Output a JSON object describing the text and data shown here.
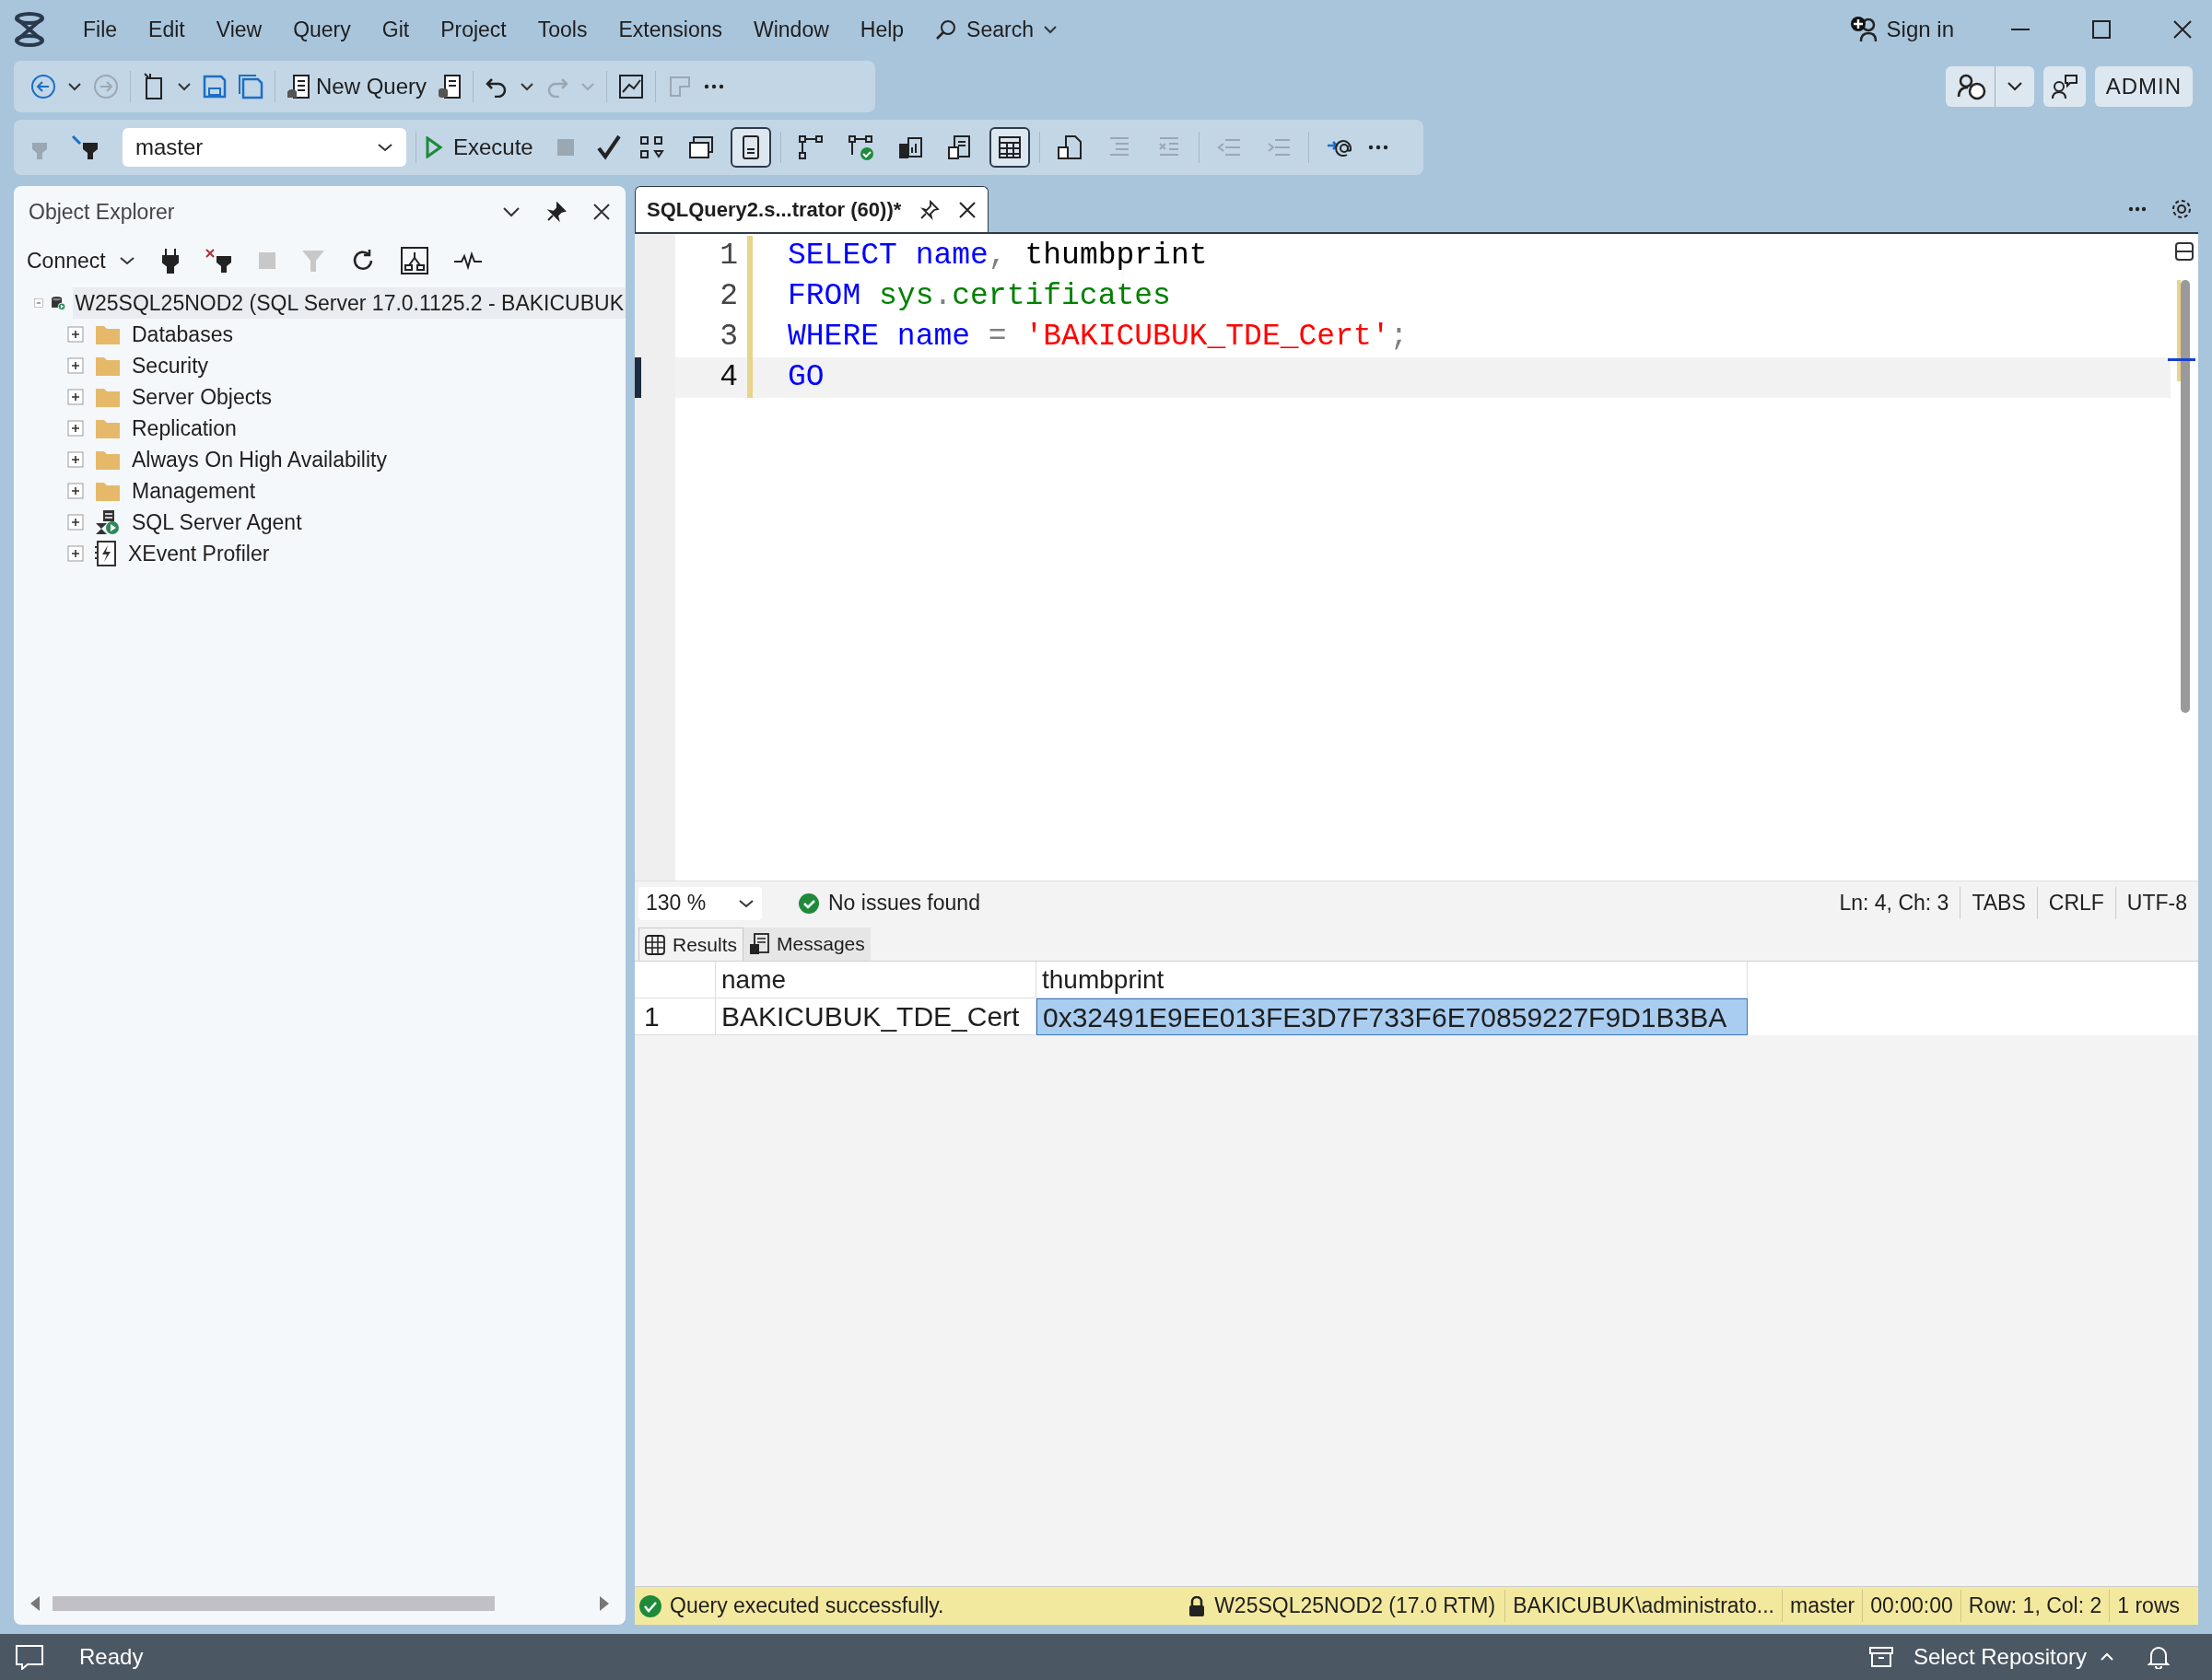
{
  "menu": {
    "items": [
      "File",
      "Edit",
      "View",
      "Query",
      "Git",
      "Project",
      "Tools",
      "Extensions",
      "Window",
      "Help"
    ],
    "search": "Search"
  },
  "account": {
    "sign_in": "Sign in",
    "profile": "ADMIN"
  },
  "toolbar": {
    "new_query": "New Query",
    "database": "master",
    "execute": "Execute"
  },
  "toolbar_buttons": [
    {
      "pressed": false,
      "disabled": false
    },
    {
      "pressed": false,
      "disabled": false
    },
    {
      "pressed": true,
      "disabled": false
    },
    {
      "pressed": false,
      "disabled": false
    },
    {
      "pressed": false,
      "disabled": false
    },
    {
      "pressed": false,
      "disabled": false
    },
    {
      "pressed": false,
      "disabled": false
    },
    {
      "pressed": true,
      "disabled": false
    },
    {
      "pressed": false,
      "disabled": false
    },
    {
      "pressed": false,
      "disabled": true
    },
    {
      "pressed": false,
      "disabled": true
    },
    {
      "pressed": false,
      "disabled": true
    },
    {
      "pressed": false,
      "disabled": true
    },
    {
      "pressed": false,
      "disabled": false
    }
  ],
  "object_explorer": {
    "title": "Object Explorer",
    "connect": "Connect",
    "tree": {
      "label": "W25SQL25NOD2 (SQL Server 17.0.1125.2 - BAKICUBUK",
      "expanded": true,
      "selected": true,
      "children": [
        {
          "label": "Databases",
          "kind": "folder",
          "expanded": false,
          "selected": false
        },
        {
          "label": "Security",
          "kind": "folder",
          "expanded": false,
          "selected": false
        },
        {
          "label": "Server Objects",
          "kind": "folder",
          "expanded": false,
          "selected": false
        },
        {
          "label": "Replication",
          "kind": "folder",
          "expanded": false,
          "selected": false
        },
        {
          "label": "Always On High Availability",
          "kind": "folder",
          "expanded": false,
          "selected": false
        },
        {
          "label": "Management",
          "kind": "folder",
          "expanded": false,
          "selected": false
        },
        {
          "label": "SQL Server Agent",
          "kind": "agent",
          "expanded": false,
          "selected": false
        },
        {
          "label": "XEvent Profiler",
          "kind": "profiler",
          "expanded": false,
          "selected": false
        }
      ]
    }
  },
  "editor": {
    "tab": {
      "title": "SQLQuery2.s...trator (60))*",
      "selected": true
    },
    "lines": [
      {
        "number": "1",
        "current": false,
        "tokens": [
          {
            "text": "SELECT",
            "kind": "keyword"
          },
          {
            "text": " name",
            "kind": "keyword"
          },
          {
            "text": ",",
            "kind": "punct"
          },
          {
            "text": " thumbprint",
            "kind": "ident"
          }
        ]
      },
      {
        "number": "2",
        "current": false,
        "tokens": [
          {
            "text": "FROM",
            "kind": "keyword"
          },
          {
            "text": " sys",
            "kind": "system"
          },
          {
            "text": ".",
            "kind": "punct"
          },
          {
            "text": "certificates",
            "kind": "system"
          }
        ]
      },
      {
        "number": "3",
        "current": false,
        "tokens": [
          {
            "text": "WHERE",
            "kind": "keyword"
          },
          {
            "text": " name",
            "kind": "keyword"
          },
          {
            "text": " =",
            "kind": "punct"
          },
          {
            "text": " 'BAKICUBUK_TDE_Cert'",
            "kind": "string"
          },
          {
            "text": ";",
            "kind": "punct"
          }
        ]
      },
      {
        "number": "4",
        "current": true,
        "tokens": [
          {
            "text": "GO",
            "kind": "keyword"
          }
        ]
      }
    ],
    "zoom": "130 %",
    "issues": "No issues found",
    "position": "Ln: 4, Ch: 3",
    "indent": "TABS",
    "line_ending": "CRLF",
    "encoding": "UTF-8"
  },
  "results": {
    "tabs": [
      {
        "label": "Results",
        "selected": true
      },
      {
        "label": "Messages",
        "selected": false
      }
    ],
    "columns": [
      "name",
      "thumbprint"
    ],
    "rows": [
      {
        "number": "1",
        "cells": [
          {
            "text": "BAKICUBUK_TDE_Cert",
            "selected": false
          },
          {
            "text": "0x32491E9EE013FE3D7F733F6E70859227F9D1B3BA",
            "selected": true
          }
        ]
      }
    ]
  },
  "query_status": {
    "message": "Query executed successfully.",
    "server": "W25SQL25NOD2 (17.0 RTM)",
    "user": "BAKICUBUK\\administrato...",
    "database": "master",
    "elapsed": "00:00:00",
    "cursor": "Row: 1, Col: 2",
    "row_count": "1 rows"
  },
  "status_bar": {
    "text": "Ready",
    "repository": "Select Repository"
  }
}
